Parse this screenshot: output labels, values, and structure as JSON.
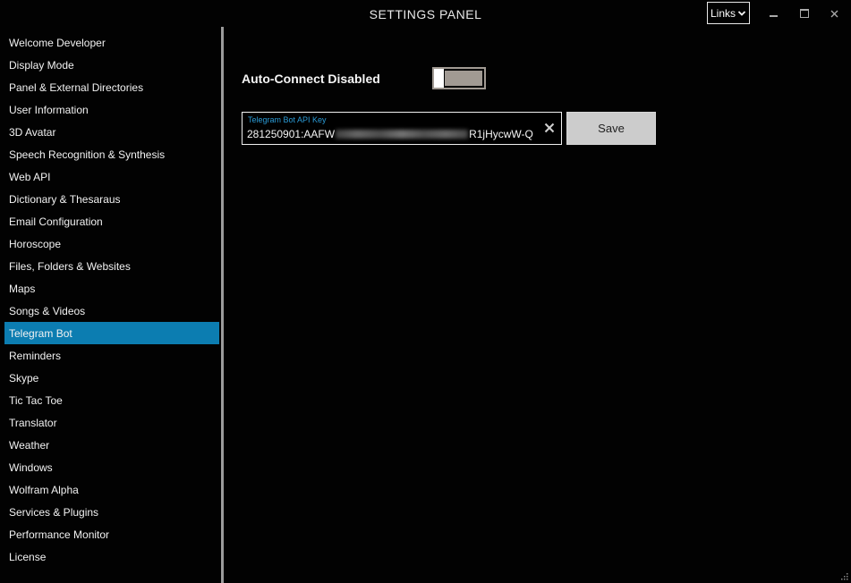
{
  "window": {
    "title": "SETTINGS PANEL",
    "links_label": "Links"
  },
  "sidebar": {
    "items": [
      {
        "label": "Welcome Developer"
      },
      {
        "label": "Display Mode"
      },
      {
        "label": "Panel & External Directories"
      },
      {
        "label": "User Information"
      },
      {
        "label": "3D Avatar"
      },
      {
        "label": "Speech Recognition & Synthesis"
      },
      {
        "label": "Web API"
      },
      {
        "label": "Dictionary & Thesaraus"
      },
      {
        "label": "Email Configuration"
      },
      {
        "label": "Horoscope"
      },
      {
        "label": "Files, Folders & Websites"
      },
      {
        "label": "Maps"
      },
      {
        "label": "Songs & Videos"
      },
      {
        "label": "Telegram Bot",
        "selected": true
      },
      {
        "label": "Reminders"
      },
      {
        "label": "Skype"
      },
      {
        "label": "Tic Tac Toe"
      },
      {
        "label": "Translator"
      },
      {
        "label": "Weather"
      },
      {
        "label": "Windows"
      },
      {
        "label": "Wolfram Alpha"
      },
      {
        "label": "Services & Plugins"
      },
      {
        "label": "Performance Monitor"
      },
      {
        "label": "License"
      }
    ]
  },
  "main": {
    "auto_connect_label": "Auto-Connect Disabled",
    "auto_connect_on": false,
    "api_key": {
      "label": "Telegram Bot API Key",
      "value_prefix": "281250901:AAFW",
      "value_suffix": "R1jHycwW-Q"
    },
    "save_label": "Save"
  },
  "colors": {
    "background": "#020202",
    "accent": "#0c7db1",
    "field_label": "#2b9bd6",
    "toggle_track": "#a19a93",
    "divider": "#9b9b9b"
  }
}
